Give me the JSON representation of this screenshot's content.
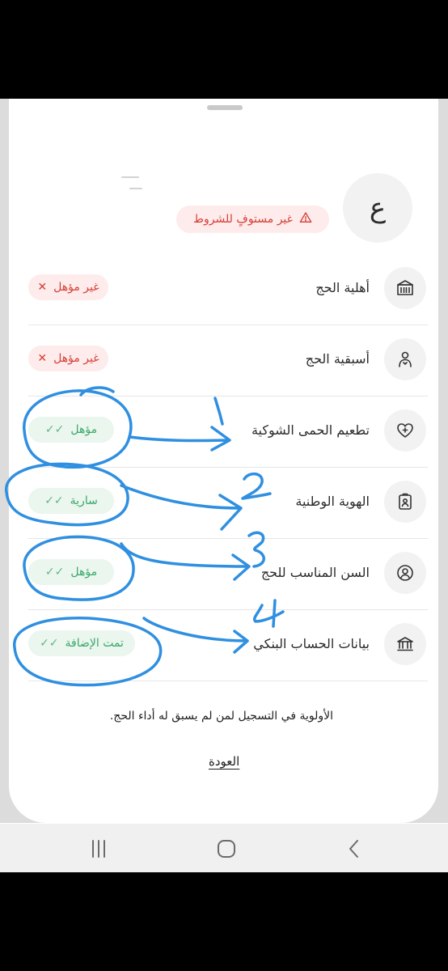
{
  "profile": {
    "avatar_letter": "ع"
  },
  "status": {
    "label": "غير مستوفٍ للشروط",
    "icon": "warning-icon"
  },
  "requirements": [
    {
      "label": "أهلية الحج",
      "icon": "building-columns-icon",
      "status": "غير مؤهل",
      "state": "fail"
    },
    {
      "label": "أسبقية الحج",
      "icon": "pilgrim-person-icon",
      "status": "غير مؤهل",
      "state": "fail"
    },
    {
      "label": "تطعيم الحمى الشوكية",
      "icon": "heart-plus-icon",
      "status": "مؤهل",
      "state": "pass"
    },
    {
      "label": "الهوية الوطنية",
      "icon": "id-badge-icon",
      "status": "سارية",
      "state": "pass"
    },
    {
      "label": "السن المناسب للحج",
      "icon": "user-circle-icon",
      "status": "مؤهل",
      "state": "pass"
    },
    {
      "label": "بيانات الحساب البنكي",
      "icon": "bank-icon",
      "status": "تمت الإضافة",
      "state": "pass"
    }
  ],
  "note": "الأولوية في التسجيل لمن لم يسبق له أداء الحج.",
  "back_label": "العودة",
  "annotations": [
    "1",
    "2",
    "3",
    "4"
  ],
  "colors": {
    "fail_text": "#d83d35",
    "fail_bg": "#fdeceb",
    "pass_text": "#3ba86a",
    "pass_bg": "#eaf6ee",
    "annotation": "#2f8fe0"
  },
  "navbar": {
    "buttons": [
      "recent-apps-icon",
      "home-icon",
      "back-icon"
    ]
  }
}
